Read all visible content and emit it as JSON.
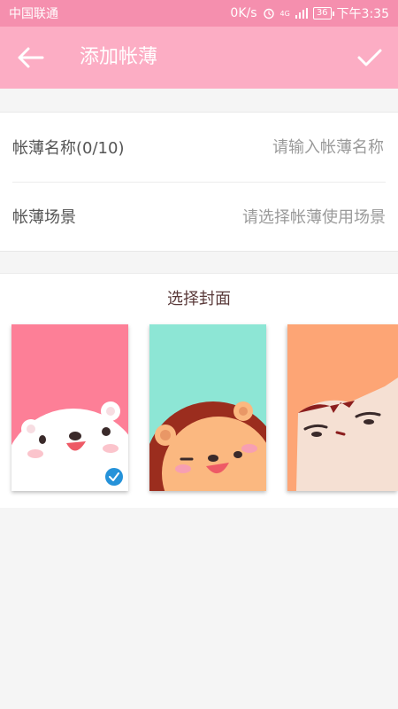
{
  "status_bar": {
    "carrier": "中国联通",
    "speed": "0K/s",
    "network": "4G",
    "battery": "36",
    "time": "下午3:35"
  },
  "app_bar": {
    "title": "添加帐薄",
    "back_icon": "arrow-left-icon",
    "confirm_icon": "check-icon"
  },
  "form": {
    "name_label": "帐薄名称(0/10)",
    "name_placeholder": "请输入帐薄名称",
    "scene_label": "帐薄场景",
    "scene_placeholder": "请选择帐薄使用场景"
  },
  "cover_section": {
    "title": "选择封面",
    "covers": [
      {
        "name": "white-bear",
        "color": "#fd7f97",
        "selected": true
      },
      {
        "name": "lion",
        "color": "#8de6d5",
        "selected": false
      },
      {
        "name": "cat",
        "color": "#fda575",
        "selected": false
      }
    ]
  },
  "colors": {
    "status_bar": "#f58fae",
    "app_bar": "#fcadc4",
    "check_blue": "#2592d9"
  }
}
